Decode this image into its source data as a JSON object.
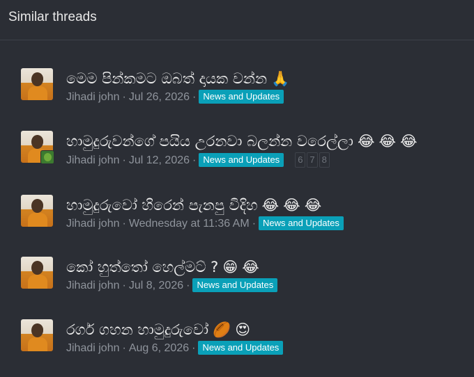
{
  "header": {
    "title": "Similar threads"
  },
  "threads": [
    {
      "title": "මෙම පින්කමට ඔබත් දායක වන්න",
      "emojis": [
        "🙏"
      ],
      "author": "Jihadi john",
      "date": "Jul 26, 2026",
      "tag": "News and Updates",
      "pages": []
    },
    {
      "title": "හාමුදුරුවන්ගේ පයිය උරනවා බලන්න වරෙල්ලා",
      "emojis": [
        "😂",
        "😂",
        "😂"
      ],
      "author": "Jihadi john",
      "date": "Jul 12, 2026",
      "tag": "News and Updates",
      "pages": [
        "6",
        "7",
        "8"
      ]
    },
    {
      "title": "හාමුදුරුවෝ හිරෙන් පැනපු විදිහ",
      "emojis": [
        "😂",
        "😂",
        "😂"
      ],
      "author": "Jihadi john",
      "date": "Wednesday at 11:36 AM",
      "tag": "News and Updates",
      "pages": []
    },
    {
      "title": "කෝ හුත්තෝ හෙල්මට් ?",
      "emojis": [
        "😁",
        "😂"
      ],
      "author": "Jihadi john",
      "date": "Jul 8, 2026",
      "tag": "News and Updates",
      "pages": []
    },
    {
      "title": "රගර් ගහන හාමුදුරුවෝ",
      "emojis": [
        "🏉",
        "😍"
      ],
      "author": "Jihadi john",
      "date": "Aug 6, 2026",
      "tag": "News and Updates",
      "pages": []
    }
  ]
}
